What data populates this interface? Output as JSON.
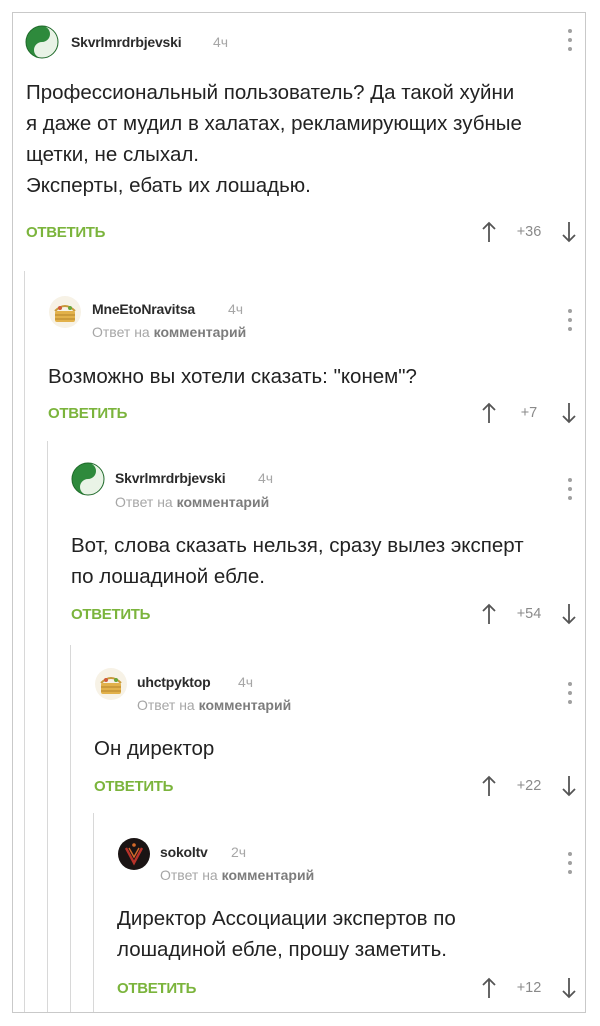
{
  "comments": [
    {
      "user": "Skvrlmrdrbjevski",
      "time": "4ч",
      "reply_prefix": "",
      "reply_target": "",
      "text": "Профессиональный пользователь? Да такой хуйни\nя даже от мудил в халатах, рекламирующих зубные\nщетки, не слыхал.\nЭксперты, ебать их лошадью.",
      "reply_label": "ОТВЕТИТЬ",
      "rating": "+36",
      "avatar": "yin-yang"
    },
    {
      "user": "MneEtoNravitsa",
      "time": "4ч",
      "reply_prefix": "Ответ на",
      "reply_target": "комментарий",
      "text": "Возможно вы хотели сказать: \"конем\"?",
      "reply_label": "ОТВЕТИТЬ",
      "rating": "+7",
      "avatar": "basket"
    },
    {
      "user": "Skvrlmrdrbjevski",
      "time": "4ч",
      "reply_prefix": "Ответ на",
      "reply_target": "комментарий",
      "text": "Вот, слова сказать нельзя, сразу вылез эксперт\nпо лошадиной ебле.",
      "reply_label": "ОТВЕТИТЬ",
      "rating": "+54",
      "avatar": "yin-yang"
    },
    {
      "user": "uhctpyktop",
      "time": "4ч",
      "reply_prefix": "Ответ на",
      "reply_target": "комментарий",
      "text": "Он директор",
      "reply_label": "ОТВЕТИТЬ",
      "rating": "+22",
      "avatar": "basket"
    },
    {
      "user": "sokoltv",
      "time": "2ч",
      "reply_prefix": "Ответ на",
      "reply_target": "комментарий",
      "text": "Директор Ассоциации экспертов по\nлошадиной ебле, прошу заметить.",
      "reply_label": "ОТВЕТИТЬ",
      "rating": "+12",
      "avatar": "dark-logo"
    }
  ],
  "colors": {
    "accent_green": "#7bb43c",
    "muted_gray": "#a6a6a6"
  }
}
